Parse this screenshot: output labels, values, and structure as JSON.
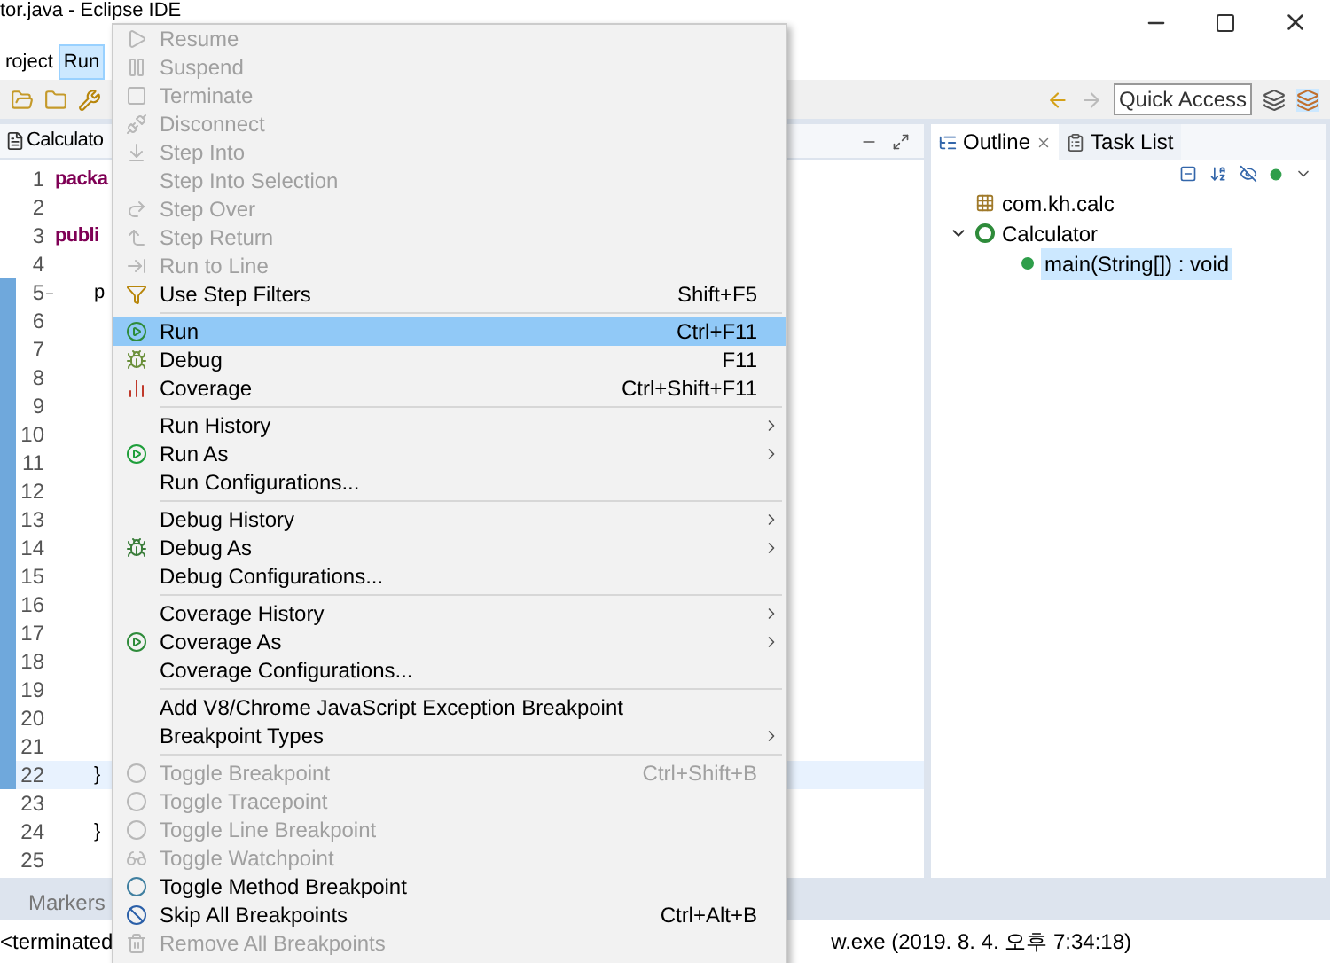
{
  "window": {
    "title": "tor.java - Eclipse IDE"
  },
  "menubar": [
    {
      "label": "roject",
      "selected": false
    },
    {
      "label": "Run",
      "selected": true
    }
  ],
  "quick_access": {
    "placeholder": "Quick Access"
  },
  "editor": {
    "tab": "Calculato",
    "lines": [
      {
        "number": "1",
        "code": "packa",
        "current": false,
        "folding": false
      },
      {
        "number": "2",
        "current": false,
        "folding": false
      },
      {
        "number": "3",
        "code": "publi",
        "current": false,
        "folding": false
      },
      {
        "number": "4",
        "current": false,
        "folding": false
      },
      {
        "number": "5",
        "code": "p",
        "current": false,
        "folding": true
      },
      {
        "number": "6",
        "current": false,
        "folding": false
      },
      {
        "number": "7",
        "current": false,
        "folding": false
      },
      {
        "number": "8",
        "current": false,
        "folding": false
      },
      {
        "number": "9",
        "current": false,
        "folding": false
      },
      {
        "number": "10",
        "current": false,
        "folding": false
      },
      {
        "number": "11",
        "current": false,
        "folding": false
      },
      {
        "number": "12",
        "current": false,
        "folding": false
      },
      {
        "number": "13",
        "current": false,
        "folding": false
      },
      {
        "number": "14",
        "current": false,
        "folding": false
      },
      {
        "number": "15",
        "current": false,
        "folding": false
      },
      {
        "number": "16",
        "current": false,
        "folding": false
      },
      {
        "number": "17",
        "current": false,
        "folding": false
      },
      {
        "number": "18",
        "current": false,
        "folding": false
      },
      {
        "number": "19",
        "current": false,
        "folding": false
      },
      {
        "number": "20",
        "current": false,
        "folding": false
      },
      {
        "number": "21",
        "current": false,
        "folding": false
      },
      {
        "number": "22",
        "code": "}",
        "current": true,
        "folding": false
      },
      {
        "number": "23",
        "current": false,
        "folding": false
      },
      {
        "number": "24",
        "code": "}",
        "current": false,
        "folding": false
      },
      {
        "number": "25",
        "current": false,
        "folding": false
      }
    ]
  },
  "outline": {
    "tabs": [
      {
        "label": "Outline",
        "selected": true
      },
      {
        "label": "Task List",
        "selected": false
      }
    ],
    "tree": [
      {
        "label": "com.kh.calc",
        "kind": "package",
        "selected": false
      },
      {
        "label": "Calculator",
        "kind": "class",
        "selected": false,
        "expanded": true,
        "children": [
          {
            "label": "main(String[]) : void",
            "kind": "method",
            "selected": true
          }
        ]
      }
    ]
  },
  "console": {
    "tab": "Markers",
    "left_text": "<terminated",
    "right_text": "w.exe (2019. 8. 4. 오후 7:34:18)"
  },
  "menu": [
    {
      "kind": "item",
      "label": "Resume",
      "disabled": true,
      "submenu": false
    },
    {
      "kind": "item",
      "label": "Suspend",
      "disabled": true,
      "submenu": false
    },
    {
      "kind": "item",
      "label": "Terminate",
      "disabled": true,
      "submenu": false
    },
    {
      "kind": "item",
      "label": "Disconnect",
      "disabled": true,
      "submenu": false
    },
    {
      "kind": "item",
      "label": "Step Into",
      "disabled": true,
      "submenu": false
    },
    {
      "kind": "item",
      "label": "Step Into Selection",
      "disabled": true,
      "submenu": false
    },
    {
      "kind": "item",
      "label": "Step Over",
      "disabled": true,
      "submenu": false
    },
    {
      "kind": "item",
      "label": "Step Return",
      "disabled": true,
      "submenu": false
    },
    {
      "kind": "item",
      "label": "Run to Line",
      "disabled": true,
      "submenu": false
    },
    {
      "kind": "item",
      "label": "Use Step Filters",
      "shortcut": "Shift+F5",
      "disabled": false,
      "submenu": false
    },
    {
      "kind": "separator"
    },
    {
      "kind": "item",
      "label": "Run",
      "shortcut": "Ctrl+F11",
      "disabled": false,
      "submenu": false,
      "selected": true
    },
    {
      "kind": "item",
      "label": "Debug",
      "shortcut": "F11",
      "disabled": false,
      "submenu": false
    },
    {
      "kind": "item",
      "label": "Coverage",
      "shortcut": "Ctrl+Shift+F11",
      "disabled": false,
      "submenu": false
    },
    {
      "kind": "separator"
    },
    {
      "kind": "item",
      "label": "Run History",
      "submenu": true,
      "disabled": false
    },
    {
      "kind": "item",
      "label": "Run As",
      "submenu": true,
      "disabled": false
    },
    {
      "kind": "item",
      "label": "Run Configurations...",
      "disabled": false,
      "submenu": false
    },
    {
      "kind": "separator"
    },
    {
      "kind": "item",
      "label": "Debug History",
      "submenu": true,
      "disabled": false
    },
    {
      "kind": "item",
      "label": "Debug As",
      "submenu": true,
      "disabled": false
    },
    {
      "kind": "item",
      "label": "Debug Configurations...",
      "disabled": false,
      "submenu": false
    },
    {
      "kind": "separator"
    },
    {
      "kind": "item",
      "label": "Coverage History",
      "submenu": true,
      "disabled": false
    },
    {
      "kind": "item",
      "label": "Coverage As",
      "submenu": true,
      "disabled": false
    },
    {
      "kind": "item",
      "label": "Coverage Configurations...",
      "disabled": false,
      "submenu": false
    },
    {
      "kind": "separator"
    },
    {
      "kind": "item",
      "label": "Add V8/Chrome JavaScript Exception Breakpoint",
      "disabled": false,
      "submenu": false
    },
    {
      "kind": "item",
      "label": "Breakpoint Types",
      "submenu": true,
      "disabled": false
    },
    {
      "kind": "separator"
    },
    {
      "kind": "item",
      "label": "Toggle Breakpoint",
      "shortcut": "Ctrl+Shift+B",
      "disabled": true,
      "submenu": false
    },
    {
      "kind": "item",
      "label": "Toggle Tracepoint",
      "disabled": true,
      "submenu": false
    },
    {
      "kind": "item",
      "label": "Toggle Line Breakpoint",
      "disabled": true,
      "submenu": false
    },
    {
      "kind": "item",
      "label": "Toggle Watchpoint",
      "disabled": true,
      "submenu": false
    },
    {
      "kind": "item",
      "label": "Toggle Method Breakpoint",
      "disabled": false,
      "submenu": false
    },
    {
      "kind": "item",
      "label": "Skip All Breakpoints",
      "shortcut": "Ctrl+Alt+B",
      "disabled": false,
      "submenu": false
    },
    {
      "kind": "item",
      "label": "Remove All Breakpoints",
      "disabled": true,
      "submenu": false
    }
  ]
}
